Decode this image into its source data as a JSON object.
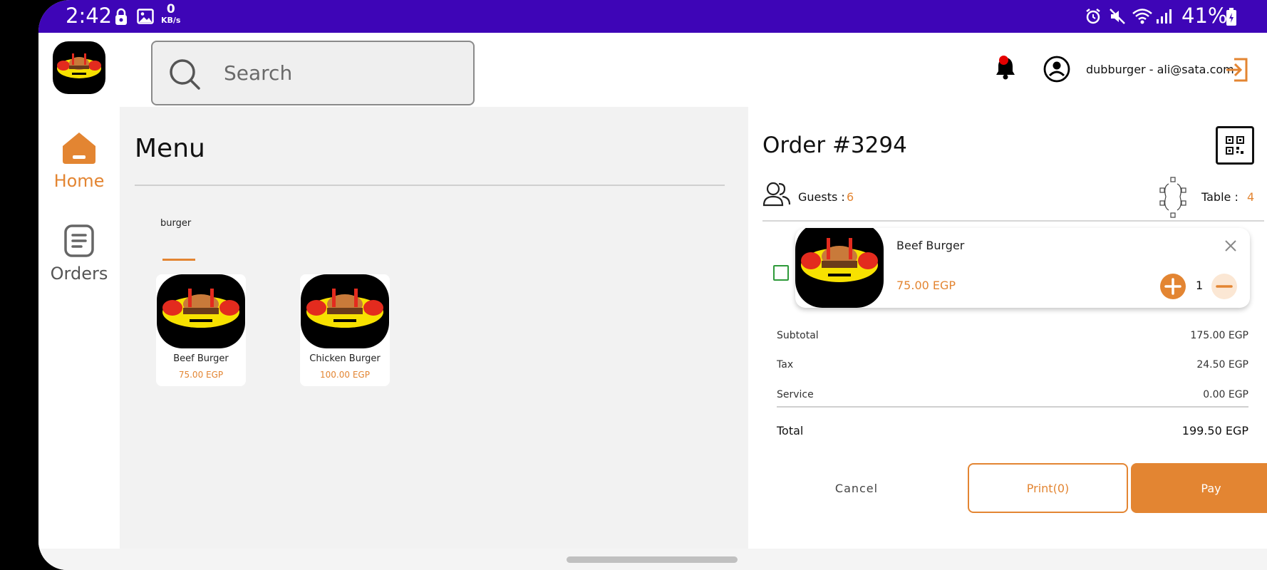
{
  "status_bar": {
    "time": "2:42",
    "net_speed_value": "0",
    "net_speed_unit": "KB/s",
    "battery": "41%"
  },
  "header": {
    "search_placeholder": "Search",
    "user_label": "dubburger - ali@sata.com"
  },
  "nav": {
    "items": [
      {
        "label": "Home",
        "icon": "home-icon",
        "active": true
      },
      {
        "label": "Orders",
        "icon": "orders-icon",
        "active": false
      }
    ]
  },
  "menu": {
    "title": "Menu",
    "category": "burger",
    "products": [
      {
        "name": "Beef Burger",
        "price": "75.00 EGP"
      },
      {
        "name": "Chicken Burger",
        "price": "100.00 EGP"
      }
    ]
  },
  "order": {
    "title": "Order #3294",
    "guests_label": "Guests :",
    "guests_value": "6",
    "table_label": "Table :",
    "table_value": "4",
    "items": [
      {
        "name": "Beef Burger",
        "price": "75.00 EGP",
        "qty": "1"
      }
    ],
    "summary": {
      "subtotal_label": "Subtotal",
      "subtotal_value": "175.00 EGP",
      "tax_label": "Tax",
      "tax_value": "24.50 EGP",
      "service_label": "Service",
      "service_value": "0.00 EGP",
      "total_label": "Total",
      "total_value": "199.50 EGP"
    },
    "actions": {
      "cancel": "Cancel",
      "print": "Print(0)",
      "pay": "Pay"
    }
  },
  "colors": {
    "status_bar": "#3e05b7",
    "accent": "#e38532",
    "panel_bg": "#f2f2f2",
    "checkbox": "#2e9a3a",
    "notification_dot": "#e50000"
  }
}
